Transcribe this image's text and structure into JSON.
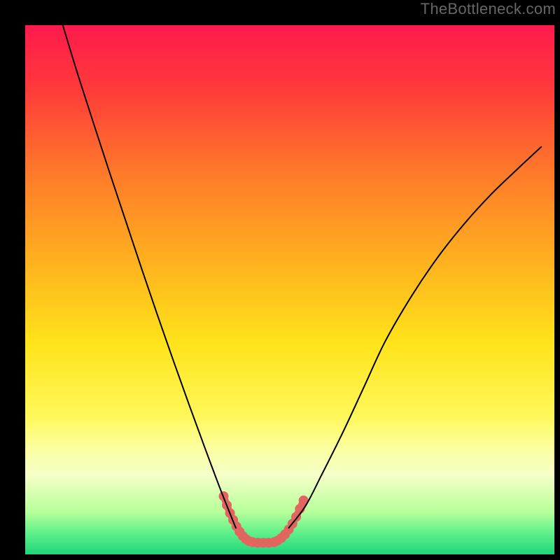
{
  "watermark": "TheBottleneck.com",
  "chart_data": {
    "type": "line",
    "title": "",
    "xlabel": "",
    "ylabel": "",
    "xlim": [
      0,
      1
    ],
    "ylim": [
      0,
      1
    ],
    "series": [
      {
        "name": "curve-left",
        "x": [
          0.071,
          0.1,
          0.13,
          0.16,
          0.19,
          0.22,
          0.25,
          0.28,
          0.31,
          0.34,
          0.37,
          0.398
        ],
        "y": [
          1.0,
          0.905,
          0.812,
          0.72,
          0.63,
          0.54,
          0.452,
          0.366,
          0.282,
          0.2,
          0.12,
          0.05
        ]
      },
      {
        "name": "curve-right",
        "x": [
          0.498,
          0.53,
          0.56,
          0.6,
          0.64,
          0.68,
          0.73,
          0.78,
          0.83,
          0.88,
          0.93,
          0.975
        ],
        "y": [
          0.05,
          0.092,
          0.15,
          0.23,
          0.316,
          0.402,
          0.488,
          0.562,
          0.625,
          0.68,
          0.728,
          0.77
        ]
      },
      {
        "name": "highlight-left",
        "x": [
          0.375,
          0.381,
          0.387,
          0.393,
          0.399,
          0.405,
          0.411,
          0.417,
          0.423,
          0.43
        ],
        "y": [
          0.11,
          0.093,
          0.078,
          0.065,
          0.053,
          0.043,
          0.035,
          0.029,
          0.025,
          0.023
        ]
      },
      {
        "name": "highlight-bottom",
        "x": [
          0.43,
          0.44,
          0.45,
          0.46,
          0.47
        ],
        "y": [
          0.023,
          0.022,
          0.022,
          0.022,
          0.023
        ]
      },
      {
        "name": "highlight-right",
        "x": [
          0.47,
          0.477,
          0.484,
          0.491,
          0.498,
          0.505,
          0.512,
          0.519,
          0.526
        ],
        "y": [
          0.023,
          0.026,
          0.031,
          0.038,
          0.047,
          0.058,
          0.071,
          0.086,
          0.102
        ]
      }
    ],
    "gradient_stops": [
      {
        "offset": 0.0,
        "color": "#ff1a4d"
      },
      {
        "offset": 0.12,
        "color": "#ff3a3a"
      },
      {
        "offset": 0.28,
        "color": "#ff7a2a"
      },
      {
        "offset": 0.45,
        "color": "#ffb21f"
      },
      {
        "offset": 0.6,
        "color": "#ffe31a"
      },
      {
        "offset": 0.74,
        "color": "#fff85a"
      },
      {
        "offset": 0.8,
        "color": "#fbffa0"
      },
      {
        "offset": 0.85,
        "color": "#f6ffc8"
      },
      {
        "offset": 0.92,
        "color": "#b6ff9a"
      },
      {
        "offset": 0.96,
        "color": "#5ef08a"
      },
      {
        "offset": 1.0,
        "color": "#1fd67a"
      }
    ],
    "highlight_color": "#e2665f",
    "highlight_marker_radius": 7,
    "highlight_stroke_width": 10,
    "curve_color": "#000000",
    "curve_width": 2
  }
}
